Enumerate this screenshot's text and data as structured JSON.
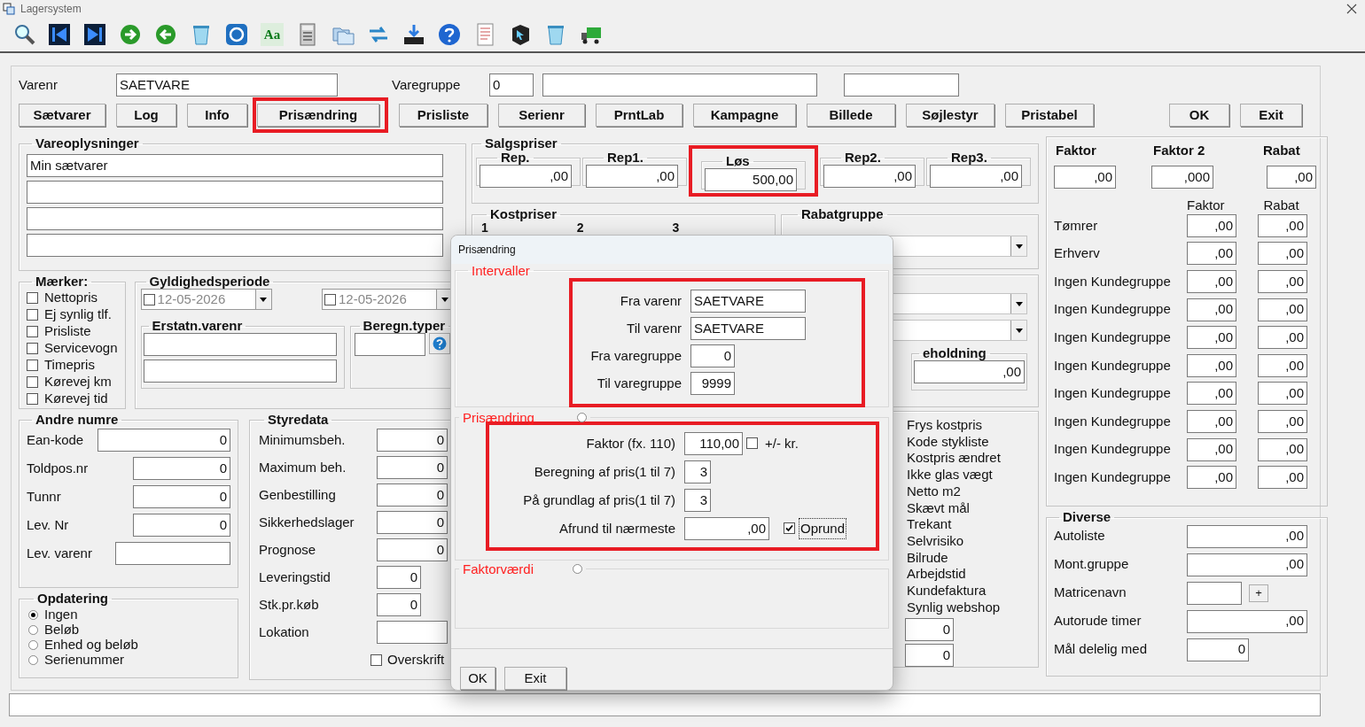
{
  "window": {
    "title": "Lagersystem"
  },
  "toolbar": {
    "font_button": "Aa"
  },
  "header": {
    "varenr_label": "Varenr",
    "varenr": "SAETVARE",
    "varegruppe_label": "Varegruppe",
    "varegruppe": "0"
  },
  "buttons": [
    {
      "label": "Sætvarer",
      "highlighted": false
    },
    {
      "label": "Log",
      "highlighted": false
    },
    {
      "label": "Info",
      "highlighted": false
    },
    {
      "label": "Prisændring",
      "highlighted": true
    },
    {
      "label": "Prisliste",
      "highlighted": false
    },
    {
      "label": "Serienr",
      "highlighted": false
    },
    {
      "label": "PrntLab",
      "highlighted": false
    },
    {
      "label": "Kampagne",
      "highlighted": false
    },
    {
      "label": "Billede",
      "highlighted": false
    },
    {
      "label": "Søjlestyr",
      "highlighted": false
    },
    {
      "label": "Pristabel",
      "highlighted": false
    }
  ],
  "main_buttons": [
    "OK",
    "Exit"
  ],
  "vareoplysninger": {
    "title": "Vareoplysninger",
    "lines": [
      "Min sætvarer"
    ]
  },
  "maerker": {
    "title": "Mærker:",
    "items": [
      {
        "label": "Nettopris",
        "checked": false
      },
      {
        "label": "Ej synlig tlf.",
        "checked": false
      },
      {
        "label": "Prisliste",
        "checked": false
      },
      {
        "label": "Servicevogn",
        "checked": false
      },
      {
        "label": "Timepris",
        "checked": false
      },
      {
        "label": "Kørevej km",
        "checked": false
      },
      {
        "label": "Kørevej tid",
        "checked": false
      }
    ]
  },
  "gyldighedsperiode": {
    "title": "Gyldighedsperiode",
    "dates": [
      {
        "value": "12-05-2026",
        "checked": false,
        "disabled": true
      },
      {
        "value": "12-05-2026",
        "checked": false,
        "disabled": true
      }
    ]
  },
  "erstatn_varenr": {
    "title": "Erstatn.varenr"
  },
  "beregn_typer": {
    "title": "Beregn.typer"
  },
  "andre_numre": {
    "title": "Andre numre",
    "fields": [
      {
        "label": "Ean-kode",
        "value": "0"
      },
      {
        "label": "Toldpos.nr",
        "value": "0"
      },
      {
        "label": "Tunnr",
        "value": "0"
      },
      {
        "label": "Lev. Nr",
        "value": "0"
      },
      {
        "label": "Lev. varenr"
      }
    ]
  },
  "opdatering": {
    "title": "Opdatering",
    "options": [
      {
        "label": "Ingen",
        "selected": true
      },
      {
        "label": "Beløb",
        "selected": false
      },
      {
        "label": "Enhed og beløb",
        "selected": false
      },
      {
        "label": "Serienummer",
        "selected": false
      }
    ]
  },
  "styredata": {
    "title": "Styredata",
    "fields": [
      {
        "label": "Minimumsbeh.",
        "value": "0"
      },
      {
        "label": "Maximum beh.",
        "value": "0"
      },
      {
        "label": "Genbestilling",
        "value": "0"
      },
      {
        "label": "Sikkerhedslager",
        "value": "0"
      },
      {
        "label": "Prognose",
        "value": "0"
      },
      {
        "label": "Leveringstid",
        "value": "0"
      },
      {
        "label": "Stk.pr.køb",
        "value": "0"
      },
      {
        "label": "Lokation"
      }
    ],
    "overskrift": {
      "label": "Overskrift",
      "checked": false
    }
  },
  "salgspriser": {
    "title": "Salgspriser",
    "prices": [
      {
        "label": "Rep.",
        "value": ",00",
        "highlighted": false
      },
      {
        "label": "Rep1.",
        "value": ",00",
        "highlighted": false
      },
      {
        "label": "Løs",
        "value": "500,00",
        "highlighted": true
      },
      {
        "label": "Rep2.",
        "value": ",00",
        "highlighted": false
      },
      {
        "label": "Rep3.",
        "value": ",00",
        "highlighted": false
      }
    ]
  },
  "kostpriser": {
    "title": "Kostpriser",
    "columns": [
      "1",
      "2",
      "3"
    ]
  },
  "rabatgruppe": {
    "title": "Rabatgruppe"
  },
  "beholdning": {
    "title": "eholdning",
    "value": ",00"
  },
  "flags": [
    "Frys kostpris",
    "Kode stykliste",
    "Kostpris ændret",
    "Ikke glas vægt",
    "Netto m2",
    "Skævt mål",
    "Trekant",
    "Selvrisiko",
    "Bilrude",
    "Arbejdstid",
    "Kundefaktura",
    "Synlig webshop"
  ],
  "counts": [
    "0",
    "0"
  ],
  "faktor_panel": {
    "headers": [
      "Faktor",
      "Faktor 2",
      "Rabat"
    ],
    "values": [
      ",00",
      ",000",
      ",00"
    ],
    "subheaders": [
      "Faktor",
      "Rabat"
    ],
    "rows": [
      {
        "label": "Tømrer",
        "faktor": ",00",
        "rabat": ",00"
      },
      {
        "label": "Erhverv",
        "faktor": ",00",
        "rabat": ",00"
      },
      {
        "label": "Ingen Kundegruppe",
        "faktor": ",00",
        "rabat": ",00"
      },
      {
        "label": "Ingen Kundegruppe",
        "faktor": ",00",
        "rabat": ",00"
      },
      {
        "label": "Ingen Kundegruppe",
        "faktor": ",00",
        "rabat": ",00"
      },
      {
        "label": "Ingen Kundegruppe",
        "faktor": ",00",
        "rabat": ",00"
      },
      {
        "label": "Ingen Kundegruppe",
        "faktor": ",00",
        "rabat": ",00"
      },
      {
        "label": "Ingen Kundegruppe",
        "faktor": ",00",
        "rabat": ",00"
      },
      {
        "label": "Ingen Kundegruppe",
        "faktor": ",00",
        "rabat": ",00"
      },
      {
        "label": "Ingen Kundegruppe",
        "faktor": ",00",
        "rabat": ",00"
      }
    ]
  },
  "diverse": {
    "title": "Diverse",
    "fields": [
      {
        "label": "Autoliste",
        "value": ",00",
        "kind": "wide"
      },
      {
        "label": "Mont.gruppe",
        "value": ",00",
        "kind": "wide"
      },
      {
        "label": "Matricenavn",
        "kind": "matrix",
        "button": "+"
      },
      {
        "label": "Autorude timer",
        "value": ",00",
        "kind": "wide"
      },
      {
        "label": "Mål delelig med",
        "value": "0",
        "kind": "narrow"
      }
    ]
  },
  "dialog": {
    "title": "Prisændring",
    "intervaller": {
      "title": "Intervaller",
      "highlighted": true,
      "fields": [
        {
          "label": "Fra varenr",
          "value": "SAETVARE",
          "kind": "text"
        },
        {
          "label": "Til varenr",
          "value": "SAETVARE",
          "kind": "text"
        },
        {
          "label": "Fra varegruppe",
          "value": "0",
          "kind": "number"
        },
        {
          "label": "Til varegruppe",
          "value": "9999",
          "kind": "number"
        }
      ]
    },
    "prisaendring": {
      "title": "Prisændring",
      "selected": false,
      "highlighted": true,
      "faktor": {
        "label": "Faktor (fx. 110)",
        "value": "110,00"
      },
      "plus_minus": {
        "label": "+/- kr.",
        "checked": false
      },
      "beregning": {
        "label": "Beregning af pris(1 til 7)",
        "value": "3"
      },
      "grundlag": {
        "label": "På grundlag af pris(1 til 7)",
        "value": "3"
      },
      "afrund": {
        "label": "Afrund til nærmeste",
        "value": ",00"
      },
      "oprund": {
        "label": "Oprund",
        "checked": true
      }
    },
    "faktorvaerdi": {
      "title": "Faktorværdi",
      "selected": false
    },
    "buttons": [
      "OK",
      "Exit"
    ]
  }
}
